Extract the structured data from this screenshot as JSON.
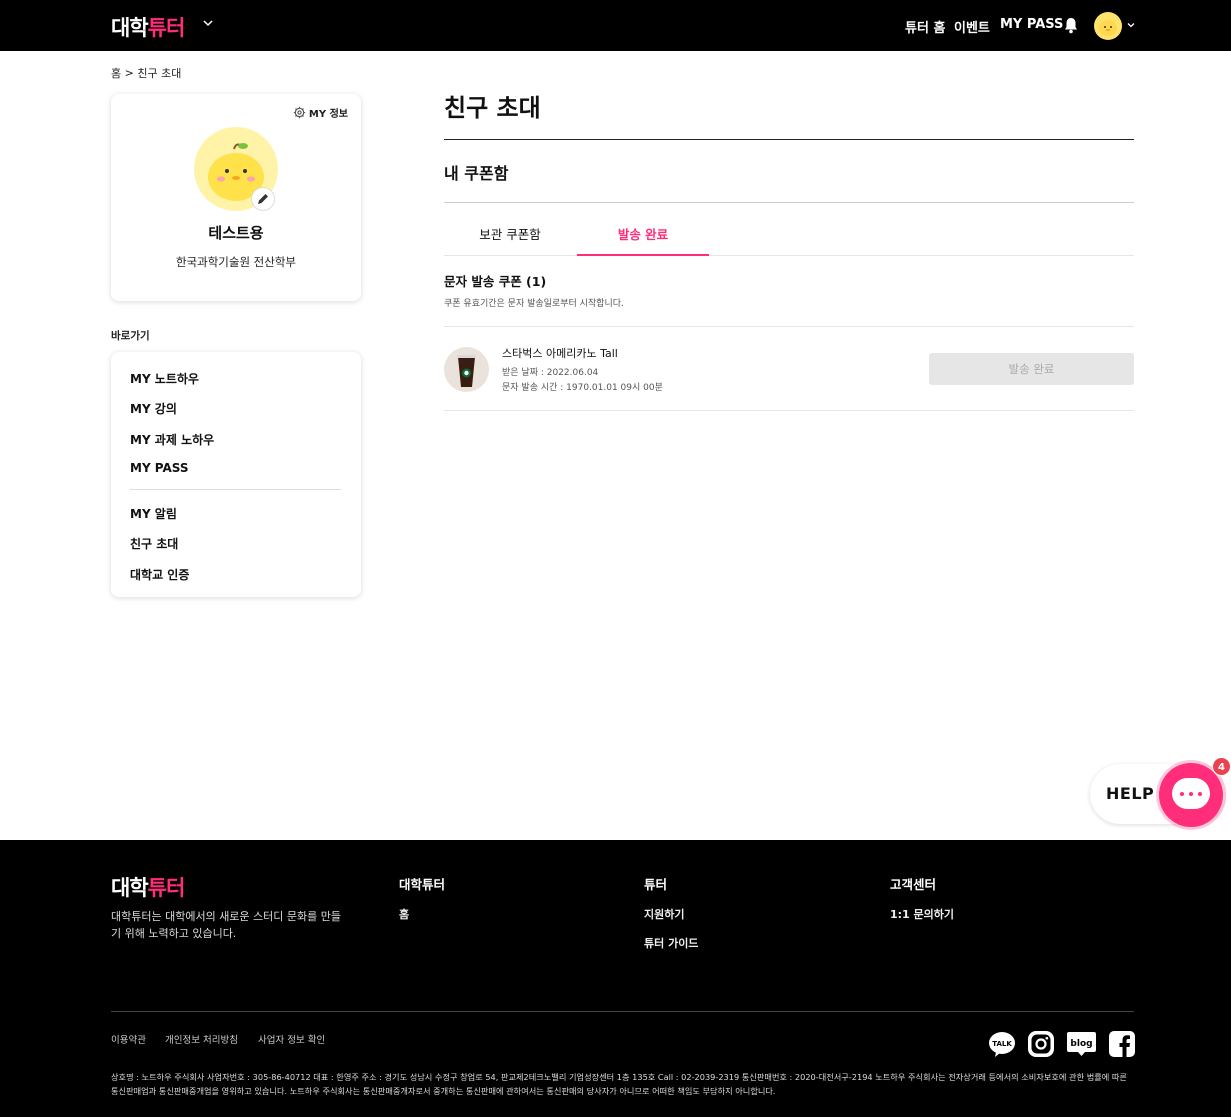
{
  "header": {
    "logo_main": "대학",
    "logo_accent": "튜터",
    "nav": [
      "튜터 홈",
      "이벤트",
      "MY PASS"
    ]
  },
  "breadcrumb": {
    "home": "홈",
    "separator": ">",
    "current": "친구 초대"
  },
  "profile": {
    "my_info_label": "MY 정보",
    "name": "테스트용",
    "school": "한국과학기술원 전산학부"
  },
  "shortcuts": {
    "label": "바로가기",
    "group1": [
      "MY 노트하우",
      "MY 강의",
      "MY 과제 노하우",
      "MY PASS"
    ],
    "group2": [
      "MY 알림",
      "친구 초대",
      "대학교 인증"
    ]
  },
  "main": {
    "title": "친구 초대",
    "subtitle": "내 쿠폰함",
    "tabs": [
      "보관 쿠폰함",
      "발송 완료"
    ],
    "active_tab": 1,
    "section_title": "문자 발송 쿠폰 (1)",
    "section_note": "쿠폰 유효기간은 문자 발송일로부터 시작합니다.",
    "coupon": {
      "name": "스타벅스 아메리카노 Tall",
      "received": "받은 날짜 : 2022.06.04",
      "sent_time": "문자 발송 시간 : 1970.01.01 09시 00분",
      "button": "발송 완료"
    }
  },
  "help": {
    "label": "HELP",
    "badge": "4"
  },
  "footer": {
    "logo_main": "대학",
    "logo_accent": "튜터",
    "description": "대학튜터는 대학에서의 새로운 스터디 문화를 만들기 위해 노력하고 있습니다.",
    "columns": [
      {
        "title": "대학튜터",
        "items": [
          "홈"
        ]
      },
      {
        "title": "튜터",
        "items": [
          "지원하기",
          "튜터 가이드"
        ]
      },
      {
        "title": "고객센터",
        "items": [
          "1:1 문의하기"
        ]
      }
    ],
    "legal_links": [
      "이용약관",
      "개인정보 처리방침",
      "사업자 정보 확인"
    ],
    "company_info": "상호명 : 노트하우 주식회사 사업자번호 : 305-86-40712 대표 : 한영주 주소 : 경기도 성남시 수정구 창업로 54, 판교제2테크노밸리 기업성장센터 1층 135호 Call : 02-2039-2319 통신판매번호 : 2020-대전서구-2194 노트하우 주식회사는 전자상거래 등에서의 소비자보호에 관한 법률에 따른 통신판매업과 통신판매중개업을 영위하고 있습니다. 노트하우 주식회사는 통신판매중개자로서 중개하는 통신판매에 관하여서는 통신판매의 당사자가 아니므로 어떠한 책임도 부담하지 아니합니다.",
    "social": [
      "kakaotalk-icon",
      "instagram-icon",
      "blog-icon",
      "facebook-icon"
    ],
    "blog_text": "blog",
    "talk_text": "TALK"
  },
  "colors": {
    "accent": "#ff2d7a",
    "badge": "#e8434f"
  }
}
